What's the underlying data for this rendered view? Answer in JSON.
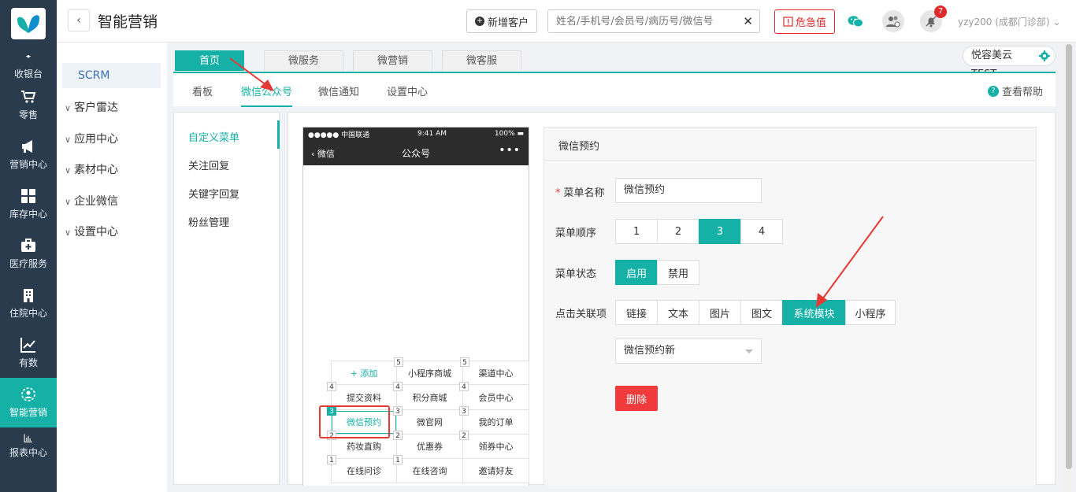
{
  "rail": {
    "items": [
      {
        "label": "收银台",
        "icon": "cashier-icon"
      },
      {
        "label": "零售",
        "icon": "cart-icon"
      },
      {
        "label": "营销中心",
        "icon": "megaphone-icon"
      },
      {
        "label": "库存中心",
        "icon": "grid-icon"
      },
      {
        "label": "医疗服务",
        "icon": "medkit-icon"
      },
      {
        "label": "住院中心",
        "icon": "building-icon"
      },
      {
        "label": "有数",
        "icon": "trend-icon"
      },
      {
        "label": "智能营销",
        "icon": "smart-marketing-icon"
      },
      {
        "label": "报表中心",
        "icon": "bar-chart-icon"
      }
    ],
    "active_index": 7
  },
  "topbar": {
    "title": "智能营销",
    "add_customer": "新增客户",
    "search_placeholder": "姓名/手机号/会员号/病历号/微信号",
    "danger_label": "危急值",
    "notification_count": "7",
    "user": "yzy200 (成都门诊部)"
  },
  "scrm": {
    "title": "SCRM",
    "items": [
      "客户雷达",
      "应用中心",
      "素材中心",
      "企业微信",
      "设置中心"
    ]
  },
  "top_tabs": [
    "首页",
    "微服务",
    "微营销",
    "微客服"
  ],
  "corp_name": "悦容美云TEST",
  "sub_nav": [
    "看板",
    "微信公众号",
    "微信通知",
    "设置中心"
  ],
  "help_label": "查看帮助",
  "side_menu": [
    "自定义菜单",
    "关注回复",
    "关键字回复",
    "粉丝管理"
  ],
  "phone": {
    "carrier": "●●●●● 中国联通",
    "time": "9:41 AM",
    "battery": "100%",
    "back": "微信",
    "title": "公众号",
    "more": "•••"
  },
  "menu_grid": {
    "columns": [
      {
        "cells": [
          "+ 添加",
          "提交资料",
          "微信预约",
          "药妆直购",
          "在线问诊"
        ],
        "tags": [
          "5",
          "4",
          "3",
          "2",
          "1"
        ]
      },
      {
        "cells": [
          "小程序商城",
          "积分商城",
          "微官网",
          "优惠券",
          "在线咨询"
        ],
        "tags": [
          "5",
          "4",
          "3",
          "2",
          "1"
        ]
      },
      {
        "cells": [
          "渠道中心",
          "会员中心",
          "我的订单",
          "领券中心",
          "邀请好友"
        ],
        "tags": [
          "5",
          "4",
          "3",
          "2",
          "1"
        ]
      }
    ]
  },
  "form": {
    "header": "微信预约",
    "name_label": "菜单名称",
    "name_value": "微信预约",
    "order_label": "菜单顺序",
    "order_options": [
      "1",
      "2",
      "3",
      "4"
    ],
    "order_selected": "3",
    "status_label": "菜单状态",
    "status_options": [
      "启用",
      "禁用"
    ],
    "status_selected": "启用",
    "link_label": "点击关联项",
    "link_options": [
      "链接",
      "文本",
      "图片",
      "图文",
      "系统模块",
      "小程序"
    ],
    "link_selected": "系统模块",
    "module_value": "微信预约新",
    "delete_label": "删除"
  },
  "colors": {
    "accent": "#15b1a7",
    "danger": "#e02b2b",
    "rail": "#2a3b4d"
  }
}
